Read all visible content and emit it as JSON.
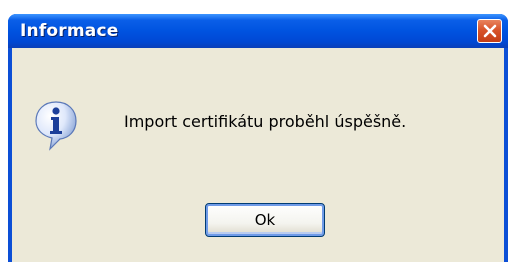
{
  "window": {
    "title": "Informace"
  },
  "dialog": {
    "message": "Import certifikátu proběhl úspěšně.",
    "icon": "info-icon",
    "ok_label": "Ok"
  },
  "colors": {
    "titlebar": "#0053e0",
    "client_bg": "#ece9d8",
    "close_button": "#d8542a"
  }
}
